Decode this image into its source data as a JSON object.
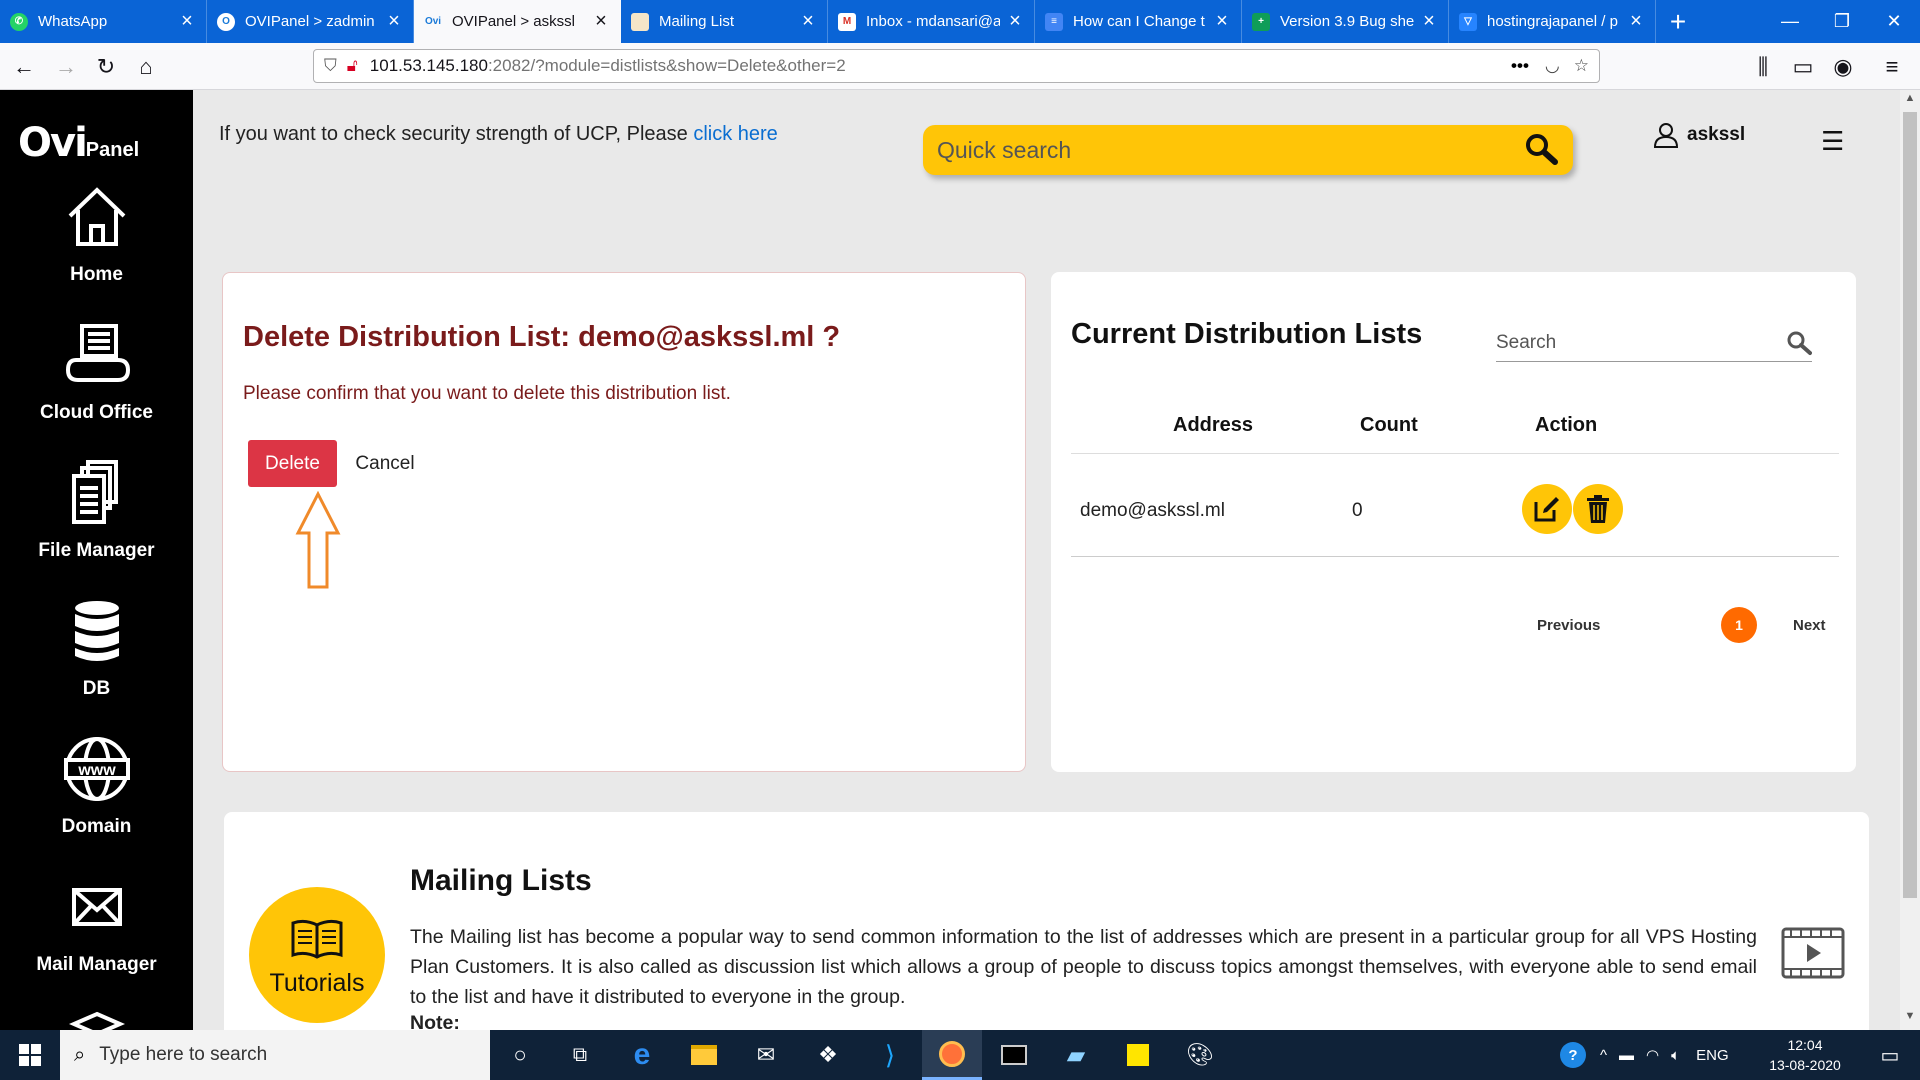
{
  "browser": {
    "tabs": [
      {
        "label": "WhatsApp",
        "icon": "whatsapp-icon",
        "color": "#25d366"
      },
      {
        "label": "OVIPanel > zadmin",
        "icon": "ovipanel-icon",
        "color": "#1a7ad8"
      },
      {
        "label": "OVIPanel > askssl",
        "icon": "ovipanel-icon",
        "color": "#1a7ad8",
        "active": true
      },
      {
        "label": "Mailing List",
        "icon": "document-icon",
        "color": "#f5e6c8"
      },
      {
        "label": "Inbox - mdansari@a",
        "icon": "gmail-icon",
        "color": "#d93025"
      },
      {
        "label": "How can I Change t",
        "icon": "google-docs-icon",
        "color": "#4285f4"
      },
      {
        "label": "Version 3.9 Bug shee",
        "icon": "google-sheets-icon",
        "color": "#0f9d58"
      },
      {
        "label": "hostingrajapanel / p",
        "icon": "bitbucket-icon",
        "color": "#2684ff"
      }
    ],
    "new_tab": "+",
    "url_host": "101.53.145.180",
    "url_path": ":2082/?module=distlists&show=Delete&other=2"
  },
  "sidebar": {
    "logo_big": "Ovi",
    "logo_small": "Panel",
    "items": [
      {
        "label": "Home",
        "icon": "home-icon"
      },
      {
        "label": "Cloud Office",
        "icon": "cloud-office-icon"
      },
      {
        "label": "File Manager",
        "icon": "file-manager-icon"
      },
      {
        "label": "DB",
        "icon": "database-icon"
      },
      {
        "label": "Domain",
        "icon": "www-icon"
      },
      {
        "label": "Mail Manager",
        "icon": "mail-icon"
      }
    ]
  },
  "header": {
    "security_text": "If you want to check security strength of UCP, Please ",
    "security_link": "click here",
    "quick_search_placeholder": "Quick search",
    "username": "askssl"
  },
  "delete_panel": {
    "title": "Delete Distribution List: demo@askssl.ml ?",
    "message": "Please confirm that you want to delete this distribution list.",
    "delete_label": "Delete",
    "cancel_label": "Cancel"
  },
  "lists_panel": {
    "title": "Current Distribution Lists",
    "search_placeholder": "Search",
    "columns": [
      "Address",
      "Count",
      "Action"
    ],
    "rows": [
      {
        "address": "demo@askssl.ml",
        "count": "0"
      }
    ],
    "pager": {
      "previous": "Previous",
      "page": "1",
      "next": "Next"
    }
  },
  "info_panel": {
    "badge": "Tutorials",
    "title": "Mailing Lists",
    "text": "The Mailing list has become a popular way to send common information to the list of addresses which are present in a particular group for all VPS Hosting Plan Customers. It is also called as discussion list which allows a group of people to discuss topics amongst themselves, with everyone able to send email to the list and have it distributed to everyone in the group.",
    "note": "Note:"
  },
  "taskbar": {
    "search_placeholder": "Type here to search",
    "language": "ENG",
    "time": "12:04",
    "date": "13-08-2020"
  },
  "colors": {
    "accent_yellow": "#ffc507",
    "delete_red": "#dc3545",
    "title_maroon": "#7a1b1b",
    "pager_orange": "#ff6a00",
    "tabstrip_blue": "#0a64d6"
  }
}
